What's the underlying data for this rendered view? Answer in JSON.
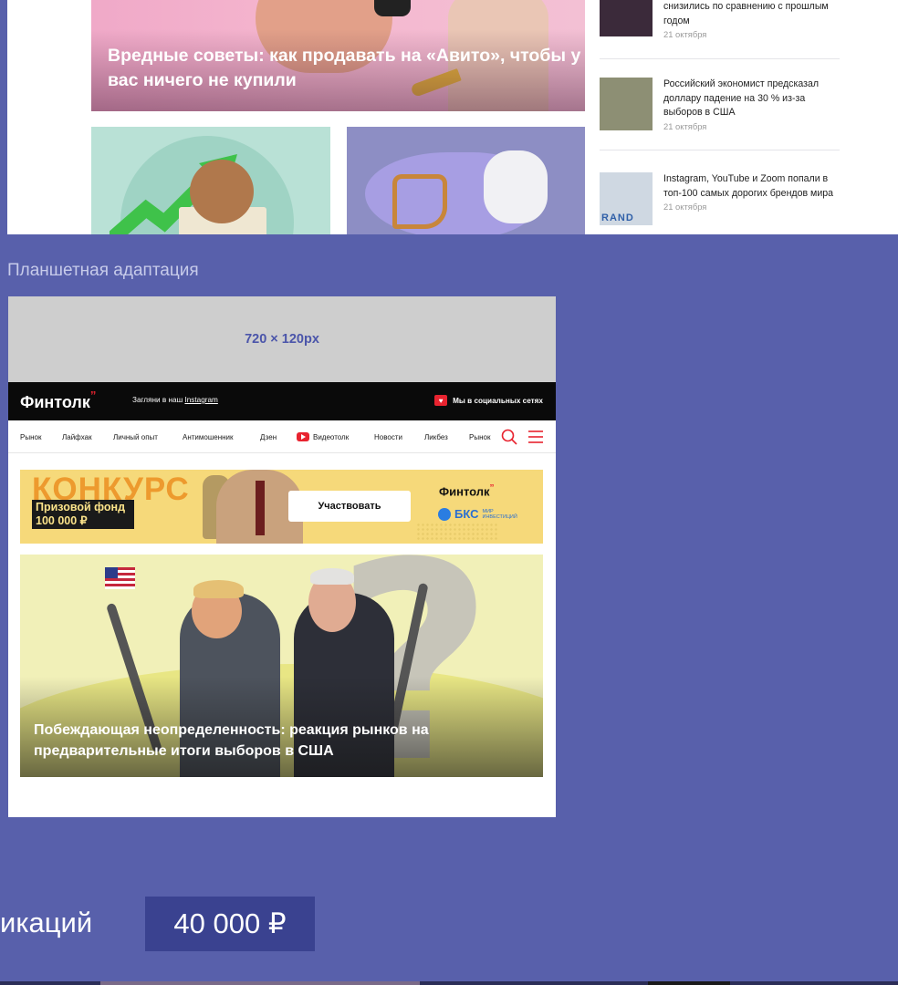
{
  "desktop": {
    "hero_title": "Вредные советы: как продавать на «Авито», чтобы у вас ничего не купили",
    "news": [
      {
        "title": "снизились по сравнению с прошлым годом",
        "date": "21 октября",
        "thumb_color": "#3b2a3a"
      },
      {
        "title": "Российский экономист предсказал доллару падение на 30 % из-за выборов в США",
        "date": "21 октября",
        "thumb_color": "#8d8f74"
      },
      {
        "title": "Instagram, YouTube и Zoom попали в топ-100 самых дорогих брендов мира",
        "date": "21 октября",
        "thumb_color": "#cfd8e2",
        "thumb_text": "RAND"
      }
    ]
  },
  "section_label": "Планшетная адаптация",
  "tablet": {
    "ad_slot_label": "720 × 120px",
    "header": {
      "logo": "Финтолк",
      "logo_mark": "”",
      "promo_prefix": "Загляни в наш ",
      "promo_link": "Instagram",
      "social": "Мы в социальных сетях"
    },
    "nav": [
      "Рынок",
      "Лайфхак",
      "Личный опыт",
      "Антимошенник",
      "Дзен",
      "Видеотолк",
      "Новости",
      "Ликбез",
      "Рынок"
    ],
    "contest": {
      "word": "КОНКУРС",
      "prize_line1": "Призовой фонд",
      "prize_line2": "100 000 ₽",
      "button": "Участвовать",
      "partner_logo": "Финтолк",
      "bks_name": "БКС",
      "bks_sub_1": "МИР",
      "bks_sub_2": "ИНВЕСТИЦИЙ"
    },
    "main_article_title": "Побеждающая неопределенность: реакция рынков на предварительные итоги выборов в США"
  },
  "bottom": {
    "label_fragment": "икаций",
    "price": "40 000 ₽"
  },
  "colors": {
    "background": "#5860ab",
    "brand_red": "#e8232f",
    "price_badge": "#3a4290",
    "ad_slot_text": "#4b55aa"
  }
}
